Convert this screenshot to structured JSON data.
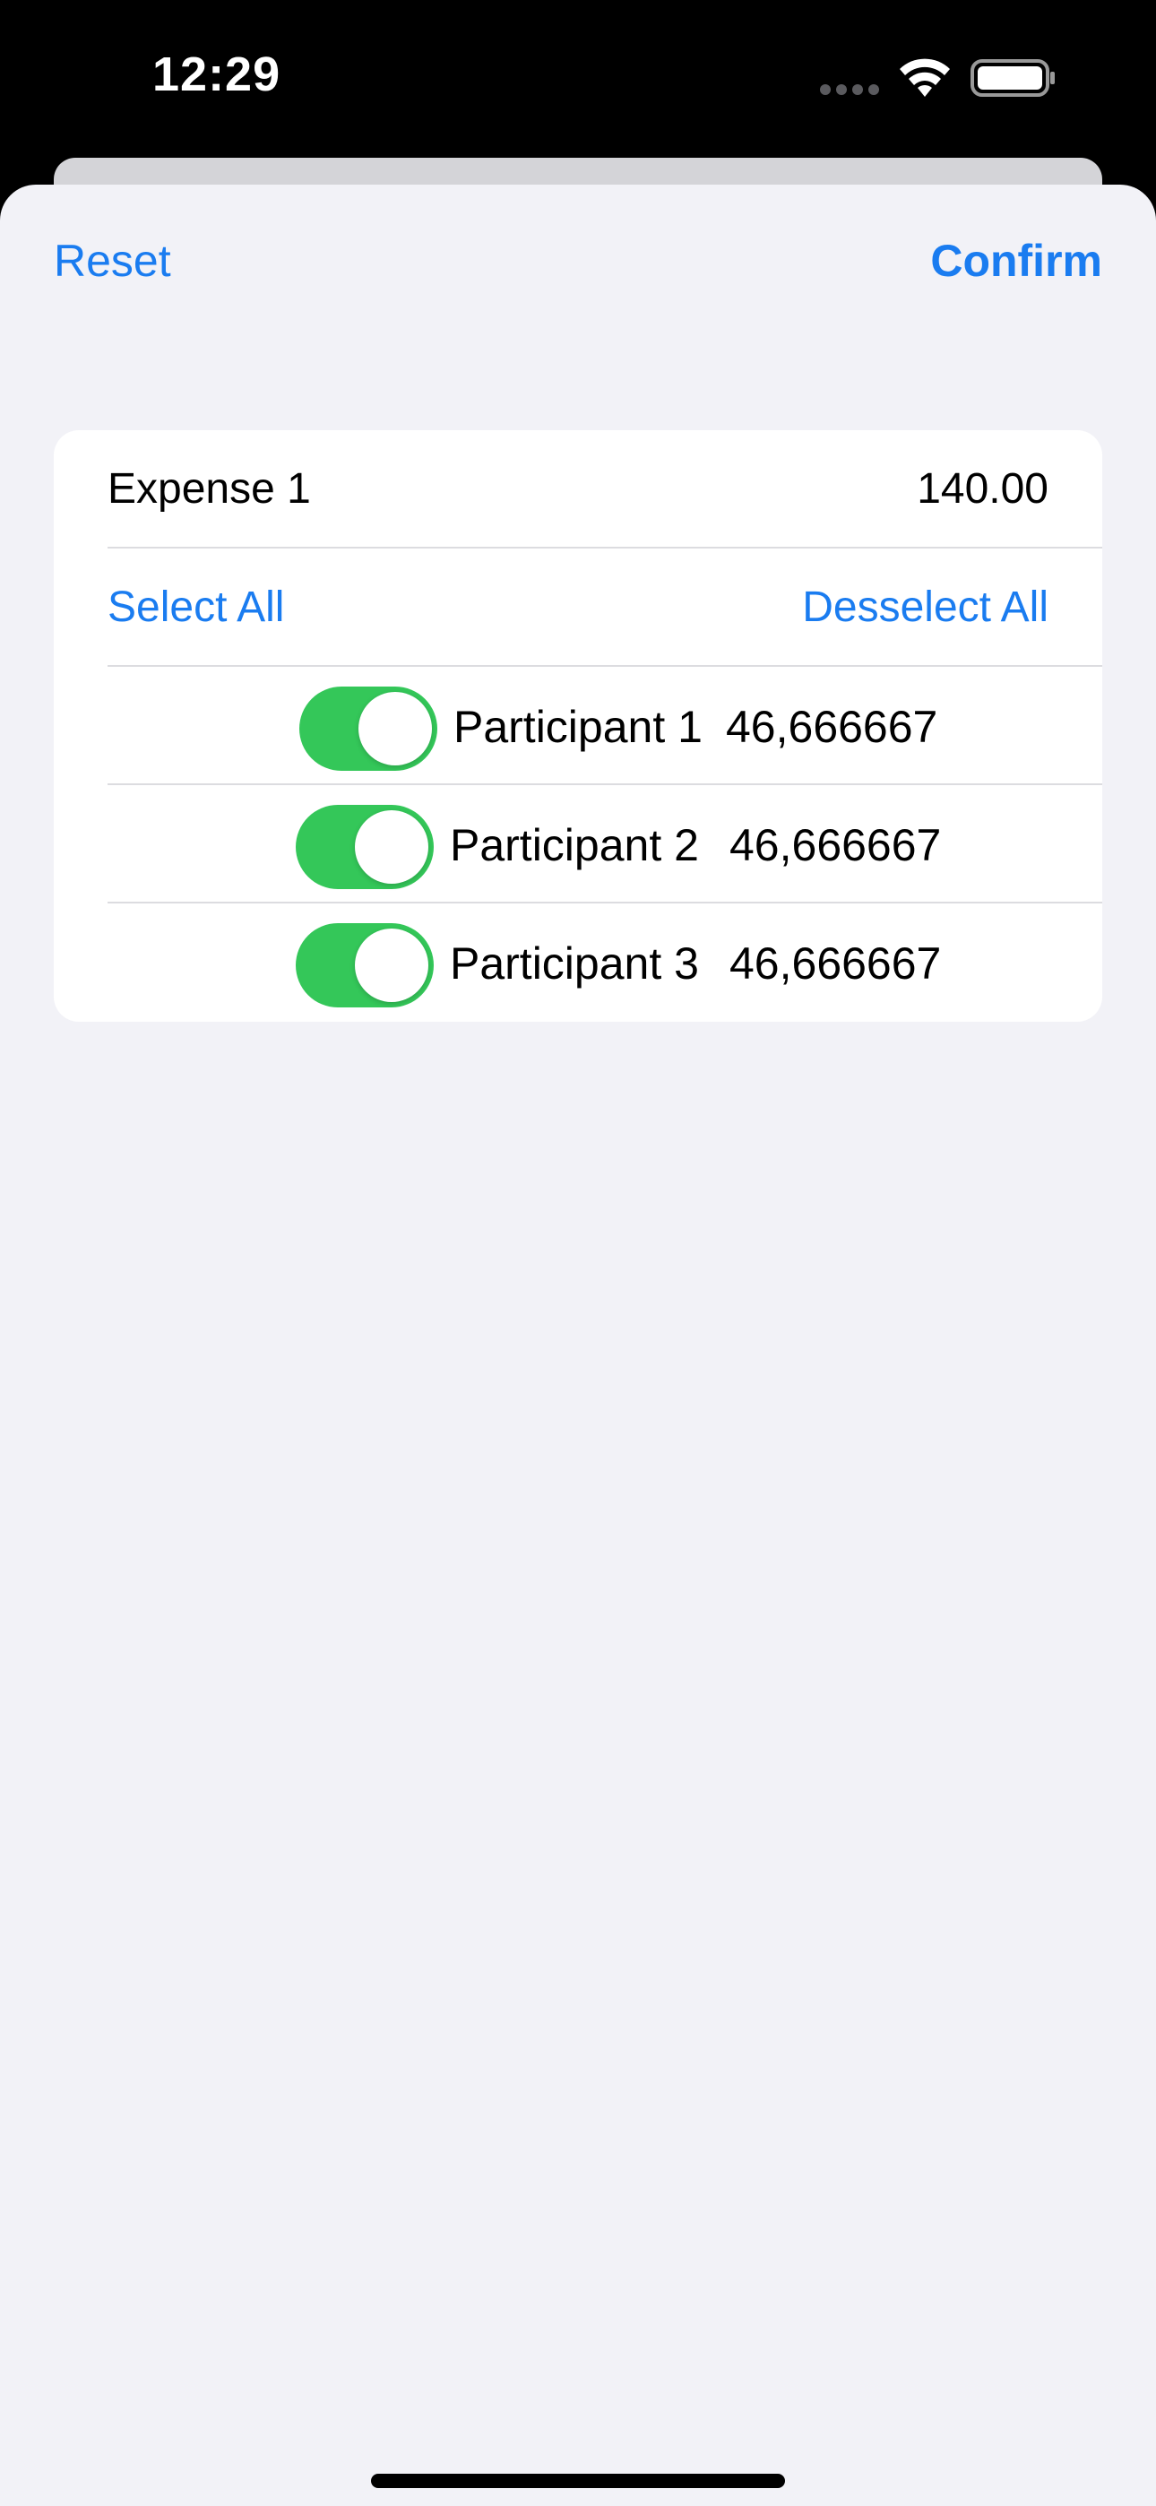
{
  "status_bar": {
    "time": "12:29"
  },
  "nav": {
    "reset_label": "Reset",
    "confirm_label": "Confirm"
  },
  "expense": {
    "name": "Expense 1",
    "amount": "140.00"
  },
  "selection": {
    "select_all_label": "Select All",
    "deselect_all_label": "Desselect All"
  },
  "participants": [
    {
      "name": "Participant 1",
      "share": "46,666667",
      "enabled": true
    },
    {
      "name": "Participant 2",
      "share": "46,666667",
      "enabled": true
    },
    {
      "name": "Participant 3",
      "share": "46,666667",
      "enabled": true
    }
  ],
  "colors": {
    "accent": "#1a7cf0",
    "toggle_on": "#34c759",
    "background": "#f2f2f7"
  }
}
